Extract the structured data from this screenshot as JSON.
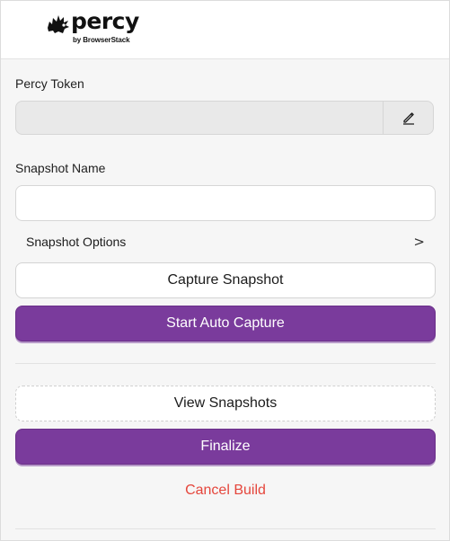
{
  "header": {
    "logo_word": "percy",
    "logo_sub": "by BrowserStack"
  },
  "token": {
    "label": "Percy Token",
    "value": ""
  },
  "snapshot": {
    "label": "Snapshot Name",
    "value": "",
    "placeholder": ""
  },
  "options": {
    "label": "Snapshot Options",
    "chevron": ">"
  },
  "actions": {
    "capture": "Capture Snapshot",
    "auto_capture": "Start Auto Capture",
    "view": "View Snapshots",
    "finalize": "Finalize",
    "cancel": "Cancel Build"
  },
  "colors": {
    "primary": "#7a3b9c",
    "danger": "#e5463c"
  },
  "icons": {
    "logo": "percy-hedgehog-icon",
    "edit": "pencil-icon"
  }
}
